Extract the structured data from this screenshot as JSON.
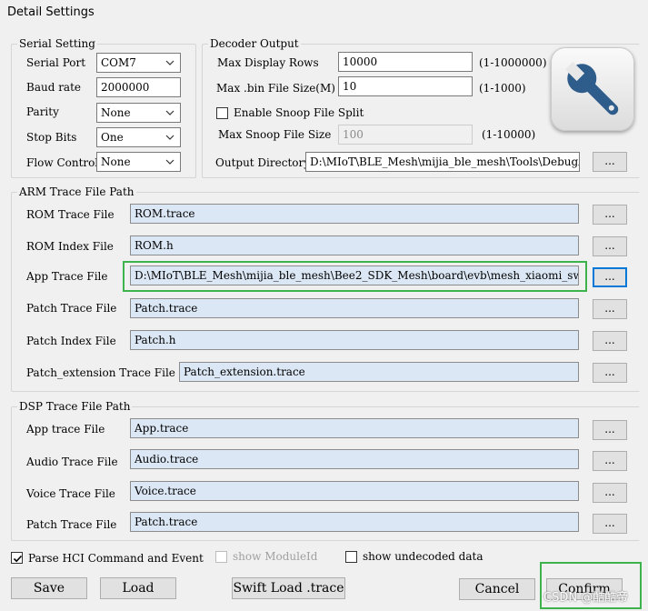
{
  "window": {
    "title": "Detail Settings"
  },
  "serial": {
    "group_title": "Serial Setting",
    "port": {
      "label": "Serial Port",
      "value": "COM7"
    },
    "baud": {
      "label": "Baud rate",
      "value": "2000000"
    },
    "parity": {
      "label": "Parity",
      "value": "None"
    },
    "stop_bits": {
      "label": "Stop Bits",
      "value": "One"
    },
    "flow": {
      "label": "Flow Control",
      "value": "None"
    }
  },
  "decoder": {
    "group_title": "Decoder Output",
    "max_rows": {
      "label": "Max Display Rows",
      "value": "10000",
      "range": "(1-1000000)"
    },
    "max_bin": {
      "label": "Max .bin File Size(M)",
      "value": "10",
      "range": "(1-1000)"
    },
    "snoop_split": {
      "label": "Enable Snoop File Split",
      "checked": false
    },
    "max_snoop": {
      "label": "Max Snoop File Size",
      "value": "100",
      "range": "(1-10000)"
    },
    "output_dir": {
      "label": "Output Directory",
      "value": "D:\\MIoT\\BLE_Mesh\\mijia_ble_mesh\\Tools\\DebugAnalyzer"
    },
    "browse": "..."
  },
  "tool_icon": "wrench-icon",
  "arm": {
    "group_title": "ARM Trace File Path",
    "rows": [
      {
        "label": "ROM Trace File",
        "value": "ROM.trace",
        "browse": "..."
      },
      {
        "label": "ROM Index File",
        "value": "ROM.h",
        "browse": "..."
      },
      {
        "label": "App Trace File",
        "value": "D:\\MIoT\\BLE_Mesh\\mijia_ble_mesh\\Bee2_SDK_Mesh\\board\\evb\\mesh_xiaomi_switch\\bin\\App.trace",
        "browse": "..."
      },
      {
        "label": "Patch Trace File",
        "value": "Patch.trace",
        "browse": "..."
      },
      {
        "label": "Patch Index File",
        "value": "Patch.h",
        "browse": "..."
      },
      {
        "label": "Patch_extension Trace File",
        "value": "Patch_extension.trace",
        "browse": "..."
      }
    ]
  },
  "dsp": {
    "group_title": "DSP Trace File Path",
    "rows": [
      {
        "label": "App trace File",
        "value": "App.trace",
        "browse": "..."
      },
      {
        "label": "Audio Trace File",
        "value": "Audio.trace",
        "browse": "..."
      },
      {
        "label": "Voice Trace File",
        "value": "Voice.trace",
        "browse": "..."
      },
      {
        "label": "Patch Trace File",
        "value": "Patch.trace",
        "browse": "..."
      }
    ]
  },
  "options": {
    "parse_hci": {
      "label": "Parse HCI Command and Event",
      "checked": true
    },
    "show_module": {
      "label": "show ModuleId",
      "checked": false,
      "enabled": false
    },
    "show_undecoded": {
      "label": "show undecoded data",
      "checked": false
    }
  },
  "buttons": {
    "save": "Save",
    "load": "Load",
    "swift_load": "Swift Load .trace",
    "cancel": "Cancel",
    "confirm": "Confirm"
  },
  "watermark": "CSDN @酷酷帝",
  "colors": {
    "highlight": "#3cb44b",
    "focus": "#0078d7",
    "field_blue": "#dbe7f4"
  }
}
